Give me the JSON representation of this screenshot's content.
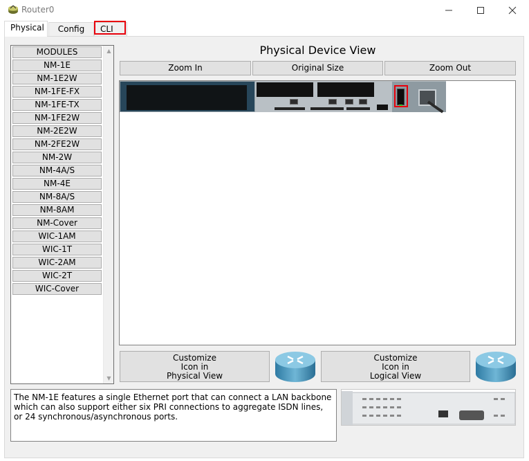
{
  "window": {
    "title": "Router0"
  },
  "tabs": [
    {
      "label": "Physical",
      "active": true
    },
    {
      "label": "Config",
      "active": false
    },
    {
      "label": "CLI",
      "active": false,
      "highlighted": true
    }
  ],
  "modules": {
    "items": [
      "MODULES",
      "NM-1E",
      "NM-1E2W",
      "NM-1FE-FX",
      "NM-1FE-TX",
      "NM-1FE2W",
      "NM-2E2W",
      "NM-2FE2W",
      "NM-2W",
      "NM-4A/S",
      "NM-4E",
      "NM-8A/S",
      "NM-8AM",
      "NM-Cover",
      "WIC-1AM",
      "WIC-1T",
      "WIC-2AM",
      "WIC-2T",
      "WIC-Cover"
    ]
  },
  "physical_view": {
    "title": "Physical Device View",
    "zoom_in": "Zoom In",
    "original_size": "Original Size",
    "zoom_out": "Zoom Out",
    "power_switch_highlighted": true
  },
  "customize": {
    "physical": [
      "Customize",
      "Icon in",
      "Physical View"
    ],
    "logical": [
      "Customize",
      "Icon in",
      "Logical View"
    ]
  },
  "description": "The NM-1E features a single Ethernet port that can connect a LAN backbone which can also support either six PRI connections to aggregate ISDN lines, or 24 synchronous/asynchronous ports.",
  "colors": {
    "highlight": "#e8000b",
    "chassis": "#27465a",
    "router_icon": "#3f8fb5"
  },
  "icons": [
    "router-app-icon",
    "minimize-icon",
    "maximize-icon",
    "close-icon",
    "router-icon"
  ]
}
